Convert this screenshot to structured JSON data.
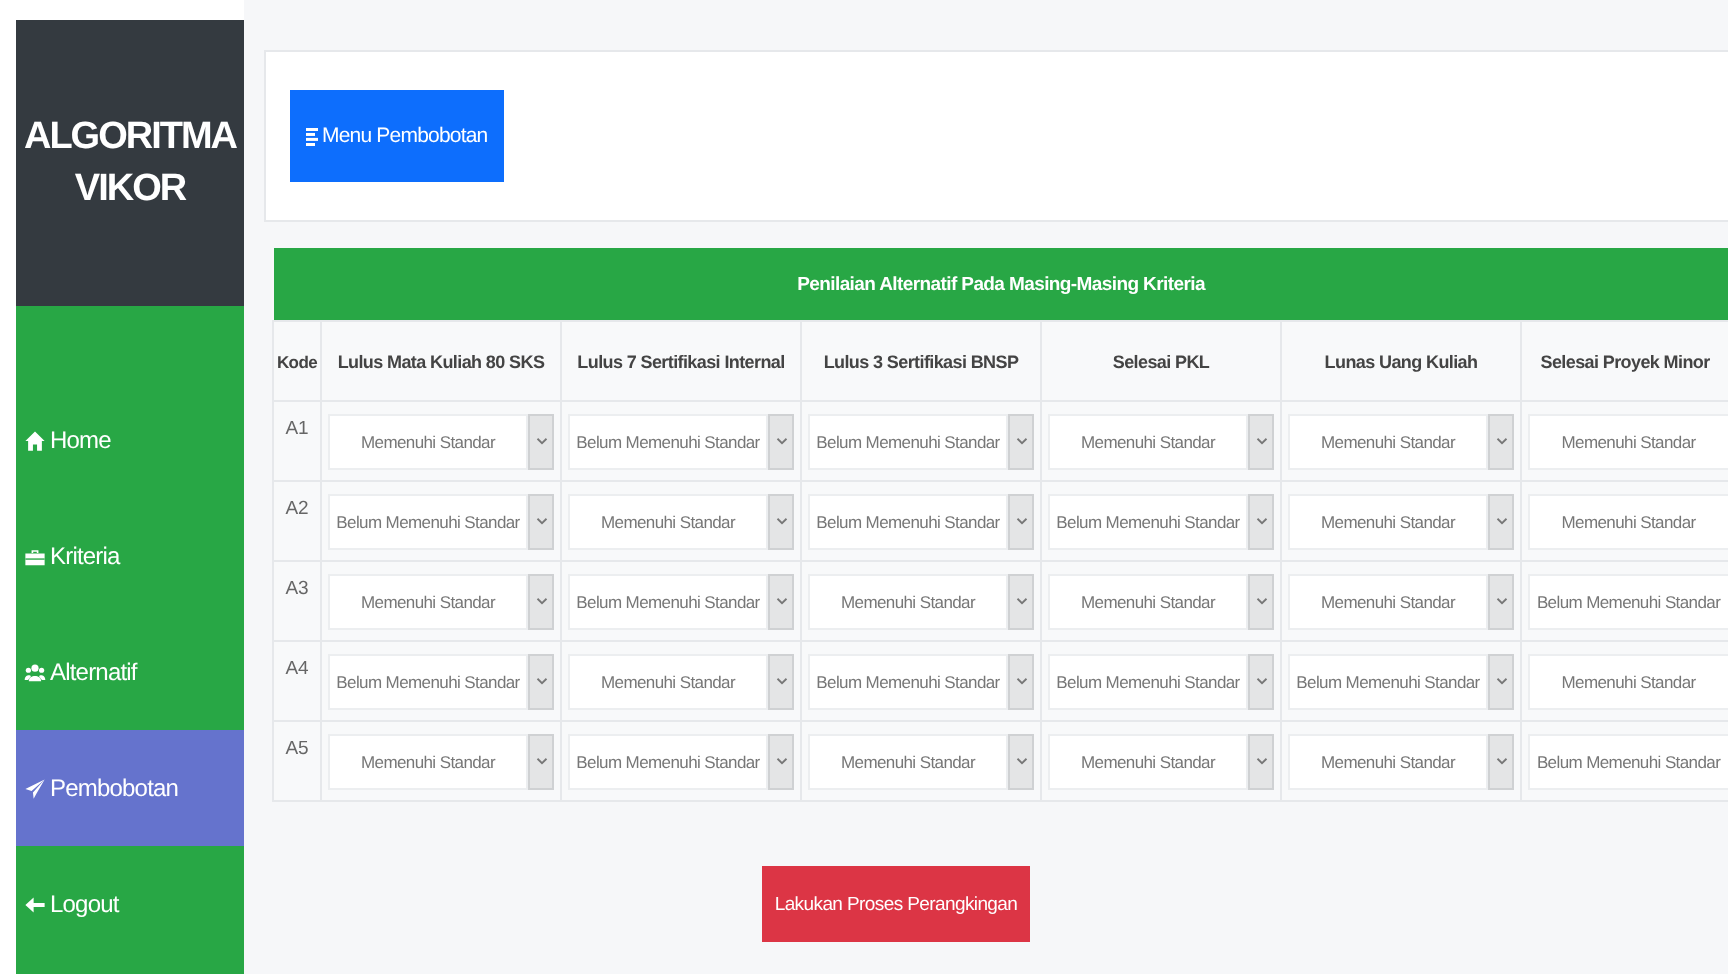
{
  "brand": {
    "line_1": "ALGORITMA",
    "line_2": "VIKOR"
  },
  "sidebar": {
    "items": [
      {
        "label": "Home",
        "selected": false
      },
      {
        "label": "Kriteria",
        "selected": false
      },
      {
        "label": "Alternatif",
        "selected": false
      },
      {
        "label": "Pembobotan",
        "selected": true
      },
      {
        "label": "Logout",
        "selected": false
      }
    ]
  },
  "menu_button": {
    "label": "Menu Pembobotan"
  },
  "table": {
    "title": "Penilaian Alternatif Pada Masing-Masing Kriteria",
    "columns": [
      "Kode",
      "Lulus Mata Kuliah 80 SKS",
      "Lulus 7 Sertifikasi Internal",
      "Lulus 3 Sertifikasi BNSP",
      "Selesai PKL",
      "Lunas Uang Kuliah",
      "Selesai Proyek Minor"
    ],
    "rows": [
      {
        "code": "A1",
        "values": [
          "Memenuhi Standar",
          "Belum Memenuhi Standar",
          "Belum Memenuhi Standar",
          "Memenuhi Standar",
          "Memenuhi Standar",
          "Memenuhi Standar"
        ]
      },
      {
        "code": "A2",
        "values": [
          "Belum Memenuhi Standar",
          "Memenuhi Standar",
          "Belum Memenuhi Standar",
          "Belum Memenuhi Standar",
          "Memenuhi Standar",
          "Memenuhi Standar"
        ]
      },
      {
        "code": "A3",
        "values": [
          "Memenuhi Standar",
          "Belum Memenuhi Standar",
          "Memenuhi Standar",
          "Memenuhi Standar",
          "Memenuhi Standar",
          "Belum Memenuhi Standar"
        ]
      },
      {
        "code": "A4",
        "values": [
          "Belum Memenuhi Standar",
          "Memenuhi Standar",
          "Belum Memenuhi Standar",
          "Belum Memenuhi Standar",
          "Belum Memenuhi Standar",
          "Memenuhi Standar"
        ]
      },
      {
        "code": "A5",
        "values": [
          "Memenuhi Standar",
          "Belum Memenuhi Standar",
          "Memenuhi Standar",
          "Memenuhi Standar",
          "Memenuhi Standar",
          "Belum Memenuhi Standar"
        ]
      }
    ]
  },
  "action_button": {
    "label": "Lakukan Proses Perangkingan"
  }
}
